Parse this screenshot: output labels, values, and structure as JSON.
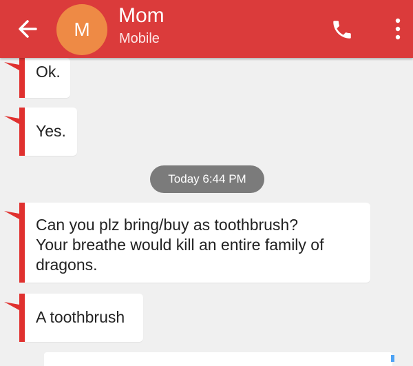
{
  "header": {
    "avatar_initial": "M",
    "contact_name": "Mom",
    "contact_type": "Mobile",
    "bar_color": "#db3b3b",
    "avatar_color": "#ee8a45",
    "icons": {
      "back": "arrow-left-icon",
      "call": "phone-icon",
      "menu": "more-vertical-icon"
    }
  },
  "thread": {
    "incoming_accent": "#e0312f",
    "messages": [
      {
        "text": "Ok."
      },
      {
        "text": "Yes."
      },
      {
        "text": "Can you plz bring/buy as toothbrush?\nYour breathe would kill an entire family of dragons."
      },
      {
        "text": "A toothbrush"
      }
    ],
    "timestamp": "Today 6:44 PM"
  }
}
